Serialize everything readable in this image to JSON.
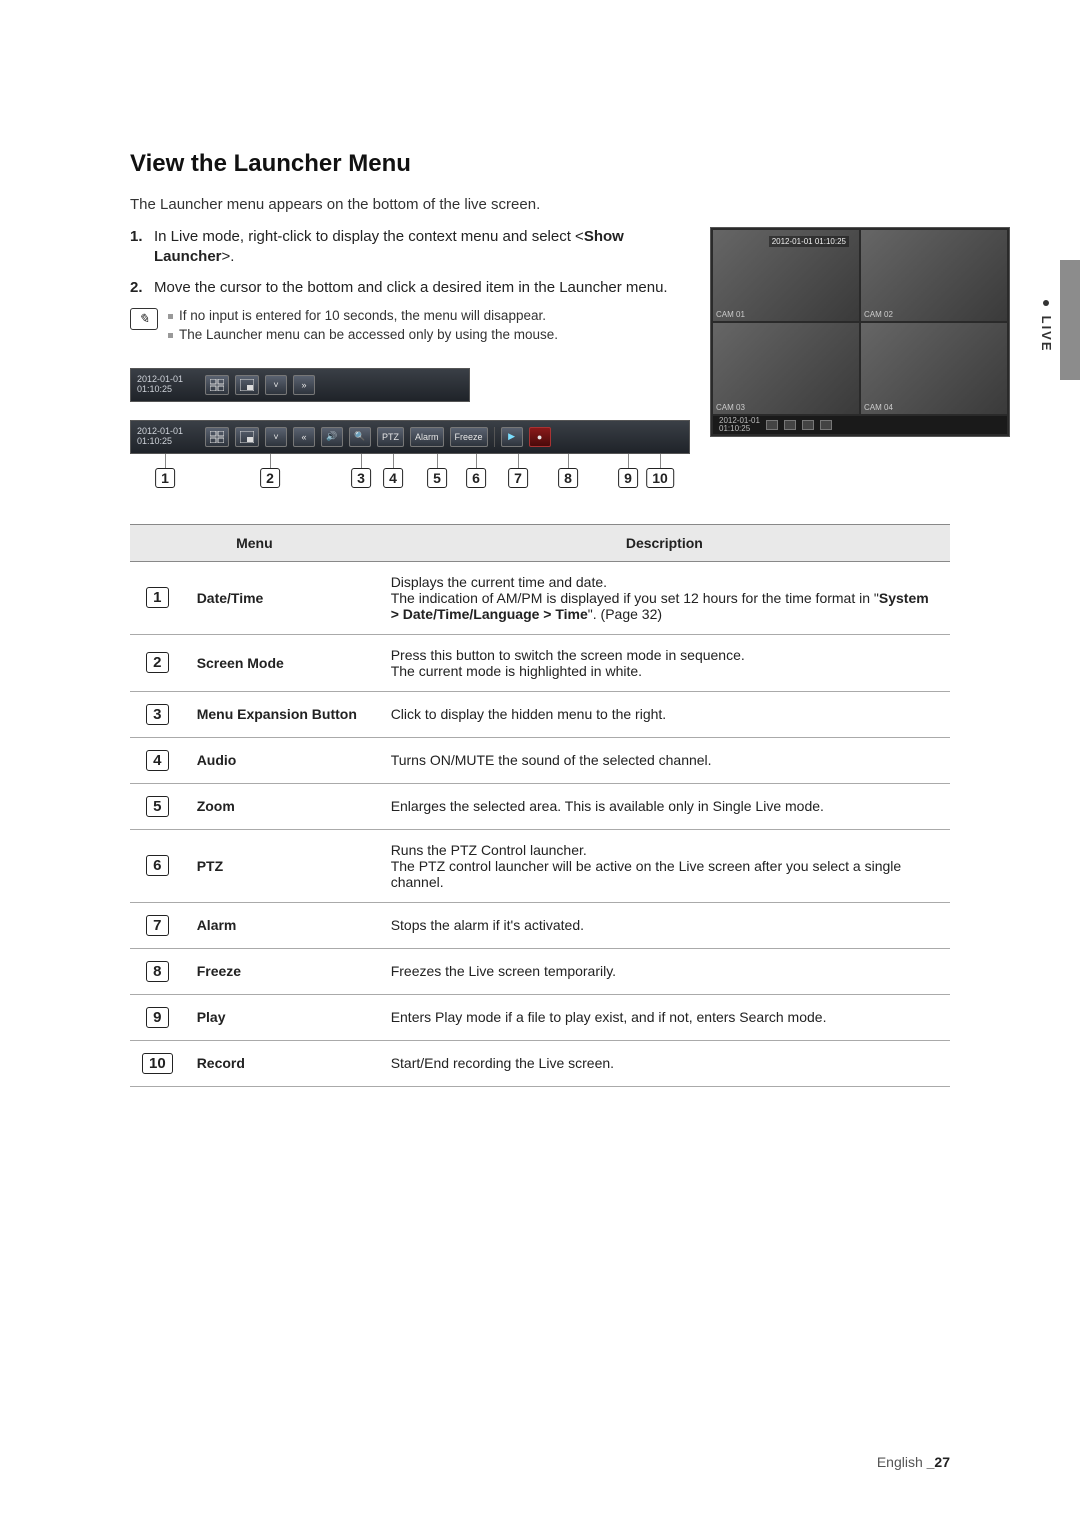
{
  "side_label": "LIVE",
  "title": "View the Launcher Menu",
  "intro": "The Launcher menu appears on the bottom of the live screen.",
  "step1_num": "1.",
  "step1_a": "In Live mode, right-click to display the context menu and select <",
  "step1_b": "Show Launcher",
  "step1_c": ">.",
  "step2_num": "2.",
  "step2": "Move the cursor to the bottom and click a desired item in the Launcher menu.",
  "note1": "If no input is entered for 10 seconds, the menu will disappear.",
  "note2": "The Launcher menu can be accessed only by using the mouse.",
  "preview": {
    "timestamp": "2012-01-01 01:10:25",
    "cam1": "CAM 01",
    "cam2": "CAM 02",
    "cam3": "CAM 03",
    "cam4": "CAM 04",
    "bar_date1": "2012-01-01",
    "bar_date2": "01:10:25"
  },
  "launcher": {
    "date1": "2012-01-01",
    "date2": "01:10:25",
    "expand_glyph": "»",
    "collapse_glyph": "«",
    "chevron": "˅",
    "audio_glyph": "🔊",
    "zoom_glyph": "🔍",
    "ptz": "PTZ",
    "alarm": "Alarm",
    "freeze": "Freeze",
    "play_glyph": "▶",
    "rec_glyph": "●"
  },
  "callouts": {
    "c1": "1",
    "c2": "2",
    "c3": "3",
    "c4": "4",
    "c5": "5",
    "c6": "6",
    "c7": "7",
    "c8": "8",
    "c9": "9",
    "c10": "10"
  },
  "table": {
    "h_menu": "Menu",
    "h_desc": "Description",
    "r1": {
      "num": "1",
      "name": "Date/Time",
      "d1": "Displays the current time and date.",
      "d2a": "The indication of AM/PM is displayed if you set 12 hours for the time format in \"",
      "d2b": "System > Date/Time/Language > Time",
      "d2c": "\". (Page 32)"
    },
    "r2": {
      "num": "2",
      "name": "Screen Mode",
      "d1": "Press this button to switch the screen mode in sequence.",
      "d2": "The current mode is highlighted in white."
    },
    "r3": {
      "num": "3",
      "name": "Menu Expansion Button",
      "d": "Click to display the hidden menu to the right."
    },
    "r4": {
      "num": "4",
      "name": "Audio",
      "d": "Turns ON/MUTE the sound of the selected channel."
    },
    "r5": {
      "num": "5",
      "name": "Zoom",
      "d": "Enlarges the selected area. This is available only in Single Live mode."
    },
    "r6": {
      "num": "6",
      "name": "PTZ",
      "d1": "Runs the PTZ Control launcher.",
      "d2": "The PTZ control launcher will be active on the Live screen after you select a single channel."
    },
    "r7": {
      "num": "7",
      "name": "Alarm",
      "d": "Stops the alarm if it's activated."
    },
    "r8": {
      "num": "8",
      "name": "Freeze",
      "d": "Freezes the Live screen temporarily."
    },
    "r9": {
      "num": "9",
      "name": "Play",
      "d": "Enters Play mode if a file to play exist, and if not, enters Search mode."
    },
    "r10": {
      "num": "10",
      "name": "Record",
      "d": "Start/End recording the Live screen."
    }
  },
  "footer_lang": "English ",
  "footer_page": "_27"
}
